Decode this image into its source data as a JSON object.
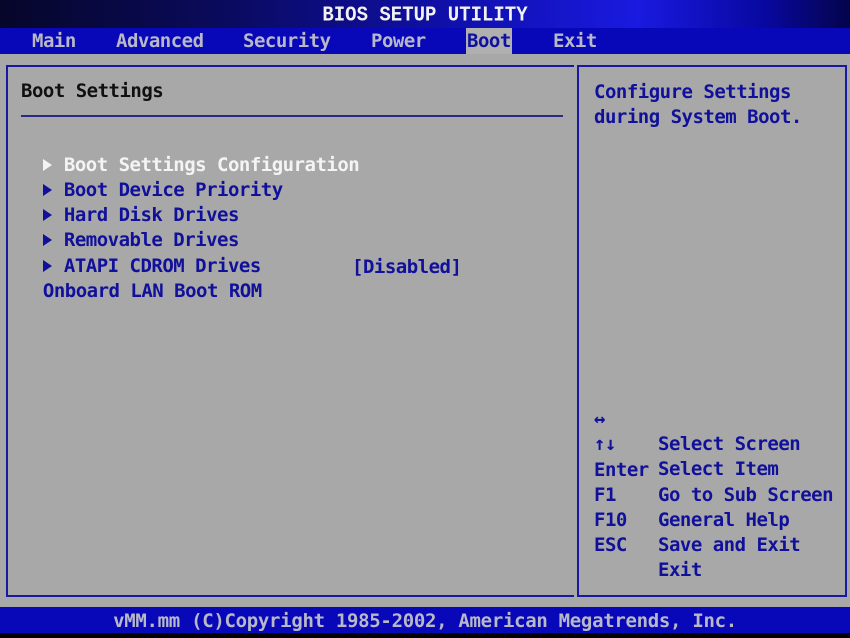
{
  "title": "BIOS SETUP UTILITY",
  "menu": {
    "tabs": [
      {
        "label": "Main",
        "active": false
      },
      {
        "label": "Advanced",
        "active": false
      },
      {
        "label": "Security",
        "active": false
      },
      {
        "label": "Power",
        "active": false
      },
      {
        "label": "Boot",
        "active": true
      },
      {
        "label": "Exit",
        "active": false
      }
    ]
  },
  "main": {
    "section_title": "Boot Settings",
    "items": [
      {
        "label": "Boot Settings Configuration",
        "submenu": true,
        "selected": true
      },
      {
        "label": "Boot Device Priority",
        "submenu": true,
        "selected": false
      },
      {
        "label": "Hard Disk Drives",
        "submenu": true,
        "selected": false
      },
      {
        "label": "Removable Drives",
        "submenu": true,
        "selected": false
      },
      {
        "label": "ATAPI CDROM Drives",
        "submenu": true,
        "selected": false
      },
      {
        "label": "Onboard LAN Boot ROM",
        "submenu": false,
        "selected": false,
        "value": "[Disabled]"
      }
    ]
  },
  "help": {
    "description": "Configure Settings\nduring System Boot.",
    "keys": [
      {
        "key": "↔",
        "desc": "Select Screen"
      },
      {
        "key": "↑↓",
        "desc": "Select Item"
      },
      {
        "key": "Enter",
        "desc": "Go to Sub Screen"
      },
      {
        "key": "F1",
        "desc": "General Help"
      },
      {
        "key": "F10",
        "desc": "Save and Exit"
      },
      {
        "key": "ESC",
        "desc": "Exit"
      }
    ]
  },
  "footer": "vMM.mm (C)Copyright 1985-2002, American Megatrends, Inc.",
  "colors": {
    "background": "#a8a8a8",
    "menubar": "#0808b8",
    "text_blue": "#10109a",
    "selected_text": "#f4f4f4",
    "frame_border": "#1818a0"
  }
}
